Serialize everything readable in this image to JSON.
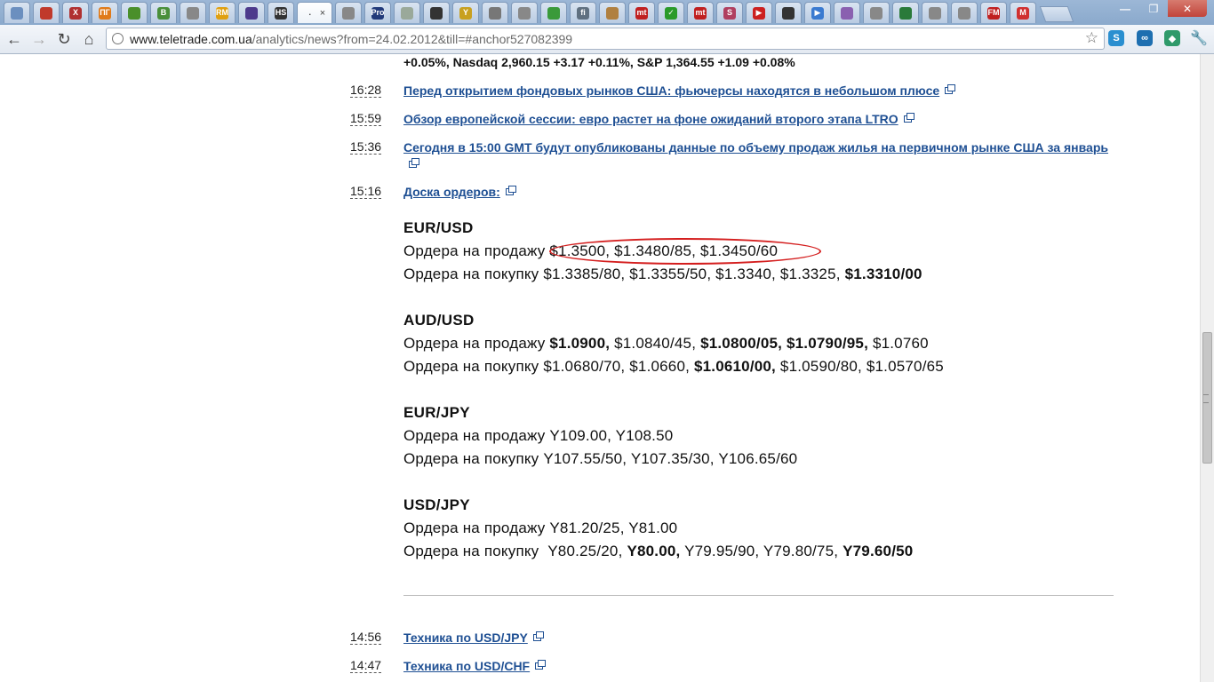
{
  "browser": {
    "tabs": [
      {
        "icon": "search-icon",
        "text": "",
        "color": "#6b8fbf"
      },
      {
        "icon": "shield-icon",
        "text": "",
        "color": "#c0392b"
      },
      {
        "icon": "x-icon",
        "text": "X",
        "color": "#b03030"
      },
      {
        "icon": "pg-icon",
        "text": "ПГ",
        "color": "#e07b1a"
      },
      {
        "icon": "flower-icon",
        "text": "",
        "color": "#4a8f2a"
      },
      {
        "icon": "vk-icon",
        "text": "B",
        "color": "#4a8f3a"
      },
      {
        "icon": "globe-icon",
        "text": "",
        "color": "#888888"
      },
      {
        "icon": "rm-icon",
        "text": "RM",
        "color": "#e0a010"
      },
      {
        "icon": "grid-icon",
        "text": "",
        "color": "#4d3a8c"
      },
      {
        "icon": "hs-icon",
        "text": "HS",
        "color": "#333333"
      },
      {
        "icon": "dot-icon",
        "text": "",
        "color": "#ffffff",
        "active": true
      },
      {
        "icon": "globe-icon",
        "text": "",
        "color": "#888888"
      },
      {
        "icon": "pro-icon",
        "text": "Pro",
        "color": "#223a7a"
      },
      {
        "icon": "doc-icon",
        "text": "",
        "color": "#9aa99a"
      },
      {
        "icon": "eye-icon",
        "text": "",
        "color": "#333333"
      },
      {
        "icon": "y-icon",
        "text": "Y",
        "color": "#c8a020"
      },
      {
        "icon": "person-icon",
        "text": "",
        "color": "#777777"
      },
      {
        "icon": "globe-icon",
        "text": "",
        "color": "#888888"
      },
      {
        "icon": "triangle-icon",
        "text": "",
        "color": "#3a9a3a"
      },
      {
        "icon": "fi-icon",
        "text": "fi",
        "color": "#607080"
      },
      {
        "icon": "hand-icon",
        "text": "",
        "color": "#b08040"
      },
      {
        "icon": "mt-icon",
        "text": "mt",
        "color": "#c02020"
      },
      {
        "icon": "check-icon",
        "text": "✓",
        "color": "#2a9a2a"
      },
      {
        "icon": "mt-icon",
        "text": "mt",
        "color": "#c02020"
      },
      {
        "icon": "s-icon",
        "text": "S",
        "color": "#b04060"
      },
      {
        "icon": "youtube-icon",
        "text": "▶",
        "color": "#cc2020"
      },
      {
        "icon": "eye-icon",
        "text": "",
        "color": "#333333"
      },
      {
        "icon": "play-icon",
        "text": "▶",
        "color": "#3a7ad0"
      },
      {
        "icon": "flower-icon",
        "text": "",
        "color": "#8a60b0"
      },
      {
        "icon": "globe-icon",
        "text": "",
        "color": "#888888"
      },
      {
        "icon": "earth-icon",
        "text": "",
        "color": "#2a7a3a"
      },
      {
        "icon": "globe-icon",
        "text": "",
        "color": "#888888"
      },
      {
        "icon": "globe-icon",
        "text": "",
        "color": "#888888"
      },
      {
        "icon": "fm-icon",
        "text": "FM",
        "color": "#c02020"
      },
      {
        "icon": "gmail-icon",
        "text": "M",
        "color": "#d03030"
      }
    ],
    "active_tab_label": ".",
    "url_host": "www.teletrade.com.ua",
    "url_rest": "/analytics/news?from=24.02.2012&till=#anchor527082399"
  },
  "news": {
    "prev_line": "+0.05%, Nasdaq 2,960.15 +3.17 +0.11%, S&P 1,364.55 +1.09 +0.08%",
    "items": [
      {
        "time": "16:28",
        "title": "Перед открытием фондовых рынков США: фьючерсы находятся в небольшом плюсе"
      },
      {
        "time": "15:59",
        "title": "Обзор европейской сессии: евро растет на фоне ожиданий второго этапа LTRO"
      },
      {
        "time": "15:36",
        "title": "Сегодня в 15:00 GMT будут опубликованы данные по объему продаж жилья на первичном рынке США за январь"
      },
      {
        "time": "15:16",
        "title": "Доска ордеров:"
      }
    ],
    "order_board": [
      {
        "pair": "EUR/USD",
        "sell_label": "Ордера на продажу",
        "sell": "$1.3500, $1.3480/85, $1.3450/60",
        "buy_label": "Ордера на покупку",
        "buy": "$1.3385/80, $1.3355/50, $1.3340, $1.3325,",
        "buy_bold": "$1.3310/00"
      },
      {
        "pair": "AUD/USD",
        "sell_label": "Ордера на продажу",
        "sell_b1": "$1.0900,",
        "sell_n1": "$1.0840/45,",
        "sell_b2": "$1.0800/05, $1.0790/95,",
        "sell_n2": "$1.0760",
        "buy_label": "Ордера на покупку",
        "buy_n1": "$1.0680/70, $1.0660,",
        "buy_b1": "$1.0610/00,",
        "buy_n2": "$1.0590/80, $1.0570/65"
      },
      {
        "pair": "EUR/JPY",
        "sell_label": "Ордера на продажу",
        "sell": "Y109.00, Y108.50",
        "buy_label": "Ордера на покупку",
        "buy": "Y107.55/50, Y107.35/30, Y106.65/60"
      },
      {
        "pair": "USD/JPY",
        "sell_label": "Ордера на продажу",
        "sell": "Y81.20/25, Y81.00",
        "buy_label": "Ордера на покупку",
        "buy_n1": "Y80.25/20,",
        "buy_b1": "Y80.00,",
        "buy_n2": "Y79.95/90, Y79.80/75,",
        "buy_b2": "Y79.60/50"
      }
    ],
    "later_items": [
      {
        "time": "14:56",
        "title": "Техника по USD/JPY"
      },
      {
        "time": "14:47",
        "title": "Техника по USD/CHF"
      }
    ]
  }
}
